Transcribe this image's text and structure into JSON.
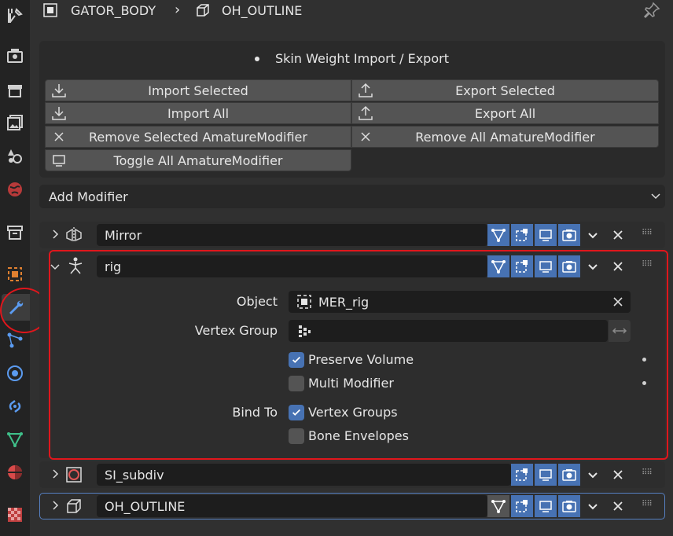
{
  "breadcrumb": {
    "object": "GATOR_BODY",
    "data": "OH_OUTLINE"
  },
  "skin_panel": {
    "title": "Skin Weight Import / Export",
    "buttons": {
      "import_selected": "Import Selected",
      "export_selected": "Export Selected",
      "import_all": "Import All",
      "export_all": "Export All",
      "remove_selected": "Remove Selected AmatureModifier",
      "remove_all": "Remove All AmatureModifier",
      "toggle_all": "Toggle All AmatureModifier"
    }
  },
  "add_modifier": {
    "label": "Add Modifier"
  },
  "modifiers": {
    "mirror": {
      "name": "Mirror"
    },
    "rig": {
      "name": "rig",
      "object_label": "Object",
      "object_value": "MER_rig",
      "vertex_group_label": "Vertex Group",
      "vertex_group_value": "",
      "preserve_volume_label": "Preserve Volume",
      "preserve_volume_checked": true,
      "multi_modifier_label": "Multi Modifier",
      "multi_modifier_checked": false,
      "bind_to_label": "Bind To",
      "vertex_groups_label": "Vertex Groups",
      "vertex_groups_checked": true,
      "bone_envelopes_label": "Bone Envelopes",
      "bone_envelopes_checked": false
    },
    "subdiv": {
      "name": "SI_subdiv"
    },
    "outline": {
      "name": "OH_OUTLINE"
    }
  },
  "colors": {
    "accent_blue": "#4772b3",
    "highlight_red": "#e0161c",
    "active_outline": "#5680c2"
  }
}
